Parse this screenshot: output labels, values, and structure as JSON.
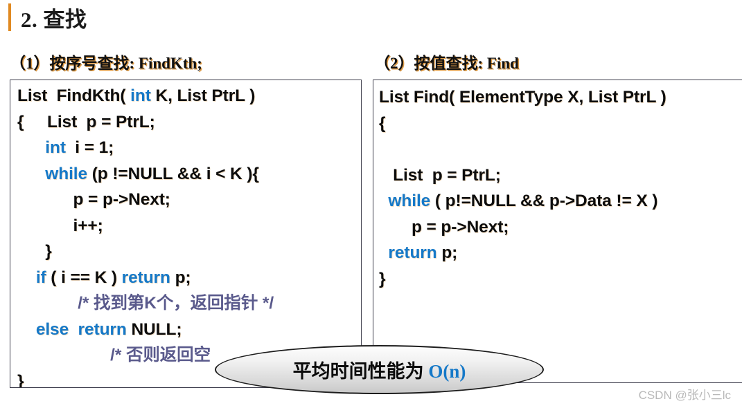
{
  "slide": {
    "title": "2. 查找",
    "accent_color": "#E08A22",
    "keyword_color": "#1679C8",
    "comment_color": "#5A5A8C"
  },
  "sections": {
    "left": {
      "heading": "（1）按序号查找: FindKth;",
      "code": [
        "List  FindKth( int K, List PtrL )",
        "{     List  p = PtrL;",
        "       int  i = 1;",
        "       while (p !=NULL && i < K ){",
        "             p = p->Next;",
        "             i++;",
        "       }",
        "     if ( i == K ) return p;",
        "              /* 找到第K个，返回指针 */",
        "     else  return NULL;",
        "                     /* 否则返回空",
        "}"
      ]
    },
    "right": {
      "heading": "（2）按值查找: Find",
      "code": [
        "List Find( ElementType X, List PtrL )",
        "{",
        "",
        "    List  p = PtrL;",
        "   while ( p!=NULL && p->Data != X )",
        "        p = p->Next;",
        "   return p;",
        "}"
      ]
    }
  },
  "callout": {
    "text_cn": "平均时间性能为 ",
    "text_bigo": "O(n)"
  },
  "watermark": {
    "text": "CSDN @张小三lc"
  }
}
